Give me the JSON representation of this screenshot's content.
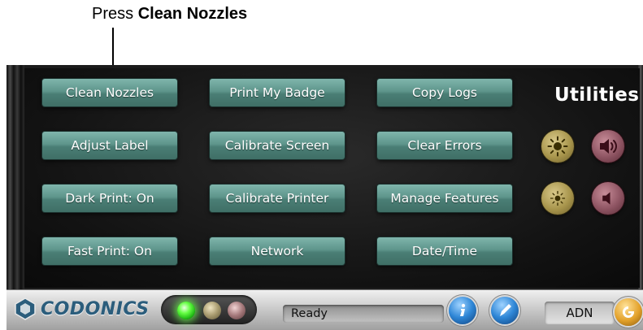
{
  "callout": {
    "prefix": "Press",
    "bold": "Clean Nozzles"
  },
  "panel": {
    "title": "Utilities",
    "buttons": [
      {
        "label": "Clean Nozzles"
      },
      {
        "label": "Print My Badge"
      },
      {
        "label": "Copy Logs"
      },
      {
        "label": "Adjust Label"
      },
      {
        "label": "Calibrate Screen"
      },
      {
        "label": "Clear Errors"
      },
      {
        "label": "Dark Print: On"
      },
      {
        "label": "Calibrate Printer"
      },
      {
        "label": "Manage Features"
      },
      {
        "label": "Fast Print: On"
      },
      {
        "label": "Network"
      },
      {
        "label": "Date/Time"
      }
    ],
    "side_controls": [
      {
        "icon": "brightness-up-icon"
      },
      {
        "icon": "volume-up-icon"
      },
      {
        "icon": "brightness-down-icon"
      },
      {
        "icon": "volume-down-icon"
      }
    ]
  },
  "statusbar": {
    "logo_text": "CODONICS",
    "status_text": "Ready",
    "user": "ADN",
    "leds": [
      "green-led",
      "amber-led",
      "red-led"
    ],
    "info_icon": "info-icon",
    "help_icon": "help-icon",
    "logout_icon": "logout-icon"
  },
  "colors": {
    "button": "#5e958b",
    "gold": "#a8954c",
    "maroon": "#8e5462",
    "logo": "#2b5d7c",
    "led_on": "#66ff44"
  }
}
